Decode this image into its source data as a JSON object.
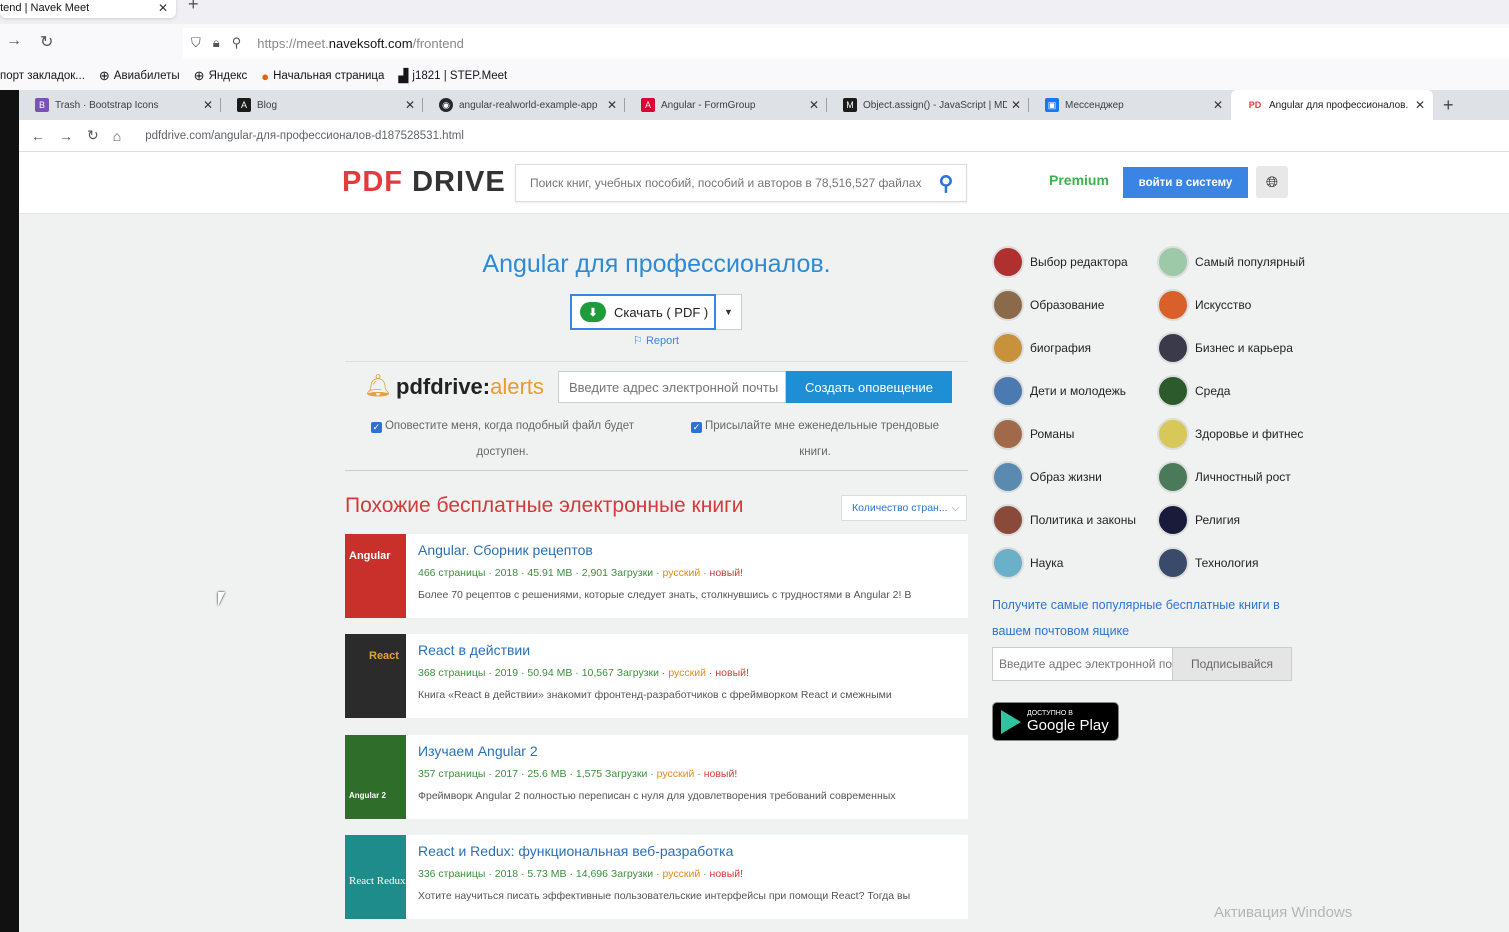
{
  "outer_browser": {
    "tab_title": "ntend | Navek Meet",
    "url_prefix": "https://meet.",
    "url_domain": "naveksoft.com",
    "url_path": "/frontend",
    "bookmarks": [
      {
        "label": "порт закладок...",
        "icon": "folder-icon"
      },
      {
        "label": "Авиабилеты",
        "icon": "globe-icon"
      },
      {
        "label": "Яндекс",
        "icon": "globe-icon"
      },
      {
        "label": "Начальная страница",
        "icon": "firefox-icon"
      },
      {
        "label": "j1821 | STEP.Meet",
        "icon": "factory-icon"
      }
    ]
  },
  "inner_browser": {
    "tabs": [
      {
        "label": "Trash · Bootstrap Icons",
        "favicon": "B",
        "color": "#7952b3"
      },
      {
        "label": "Blog",
        "favicon": "A",
        "color": "#1a1a1a"
      },
      {
        "label": "angular-realworld-example-app",
        "favicon": "◉",
        "color": "#24292e"
      },
      {
        "label": "Angular - FormGroup",
        "favicon": "A",
        "color": "#dd0031"
      },
      {
        "label": "Object.assign() - JavaScript | MD",
        "favicon": "M",
        "color": "#1b1b1b"
      },
      {
        "label": "Мессенджер",
        "favicon": "▣",
        "color": "#1877f2"
      },
      {
        "label": "Angular для профессионалов.",
        "favicon": "PD",
        "color": "#ffffff"
      }
    ],
    "url": "pdfdrive.com/angular-для-профессионалов-d187528531.html"
  },
  "header": {
    "logo_pdf": "PDF",
    "logo_drive": "DRIVE",
    "search_placeholder": "Поиск книг, учебных пособий, пособий и авторов в 78,516,527 файлах",
    "premium": "Premium",
    "login": "войти в систему"
  },
  "book": {
    "title": "Angular для профессионалов.",
    "download_label": "Скачать ( PDF )",
    "report": "Report"
  },
  "alerts": {
    "logo_main": "pdfdrive:",
    "logo_accent": "alerts",
    "email_placeholder": "Введите адрес электронной почты",
    "create_button": "Создать оповещение",
    "check1": "Оповестите меня, когда подобный файл будет доступен.",
    "check2": "Присылайте мне еженедельные трендовые книги."
  },
  "similar": {
    "title": "Похожие бесплатные электронные книги",
    "sort_label": "Количество стран..."
  },
  "books": [
    {
      "title": "Angular. Сборник рецептов",
      "meta": "466 страницы · 2018 · 45.91 MB · 2,901 Загрузки",
      "lang": "русский",
      "new": "новый!",
      "desc": "Более 70 рецептов с решениями, которые следует знать, столкнувшись с трудностями в Angular 2! В",
      "cover_color": "#c9302c",
      "cover_text": "Angular"
    },
    {
      "title": "React в действии",
      "meta": "368 страницы · 2019 · 50.94 MB · 10,567 Загрузки",
      "lang": "русский",
      "new": "новый!",
      "desc": "Книга «React в действии» знакомит фронтенд-разработчиков с фреймворком React и смежными",
      "cover_color": "#2b2b2b",
      "cover_text": "React"
    },
    {
      "title": "Изучаем Angular 2",
      "meta": "357 страницы · 2017 · 25.6 MB · 1,575 Загрузки",
      "lang": "русский",
      "new": "новый!",
      "desc": "Фреймворк Angular 2 полностью переписан с нуля для удовлетворения требований современных",
      "cover_color": "#2f6e2a",
      "cover_text": "Angular 2"
    },
    {
      "title": "React и Redux: функциональная веб-разработка",
      "meta": "336 страницы · 2018 · 5.73 MB · 14,696 Загрузки",
      "lang": "русский",
      "new": "новый!",
      "desc": "Хотите научиться писать эффективные пользовательские интерфейсы при помощи React? Тогда вы",
      "cover_color": "#1f8c8c",
      "cover_text": "React Redux"
    }
  ],
  "categories": [
    {
      "label": "Выбор редактора",
      "color": "#b03030"
    },
    {
      "label": "Самый популярный",
      "color": "#9ec9a8"
    },
    {
      "label": "Образование",
      "color": "#8a6a4a"
    },
    {
      "label": "Искусство",
      "color": "#d9602a"
    },
    {
      "label": "биография",
      "color": "#c8923c"
    },
    {
      "label": "Бизнес и карьера",
      "color": "#3a3a4a"
    },
    {
      "label": "Дети и молодежь",
      "color": "#4a7ab0"
    },
    {
      "label": "Среда",
      "color": "#2d5a2d"
    },
    {
      "label": "Романы",
      "color": "#a06a4a"
    },
    {
      "label": "Здоровье и фитнес",
      "color": "#d8c85a"
    },
    {
      "label": "Образ жизни",
      "color": "#5a8ab0"
    },
    {
      "label": "Личностный рост",
      "color": "#4a7a5a"
    },
    {
      "label": "Политика и законы",
      "color": "#8a4a3a"
    },
    {
      "label": "Религия",
      "color": "#1a1a3a"
    },
    {
      "label": "Наука",
      "color": "#6ab0c8"
    },
    {
      "label": "Технология",
      "color": "#3a4a6a"
    }
  ],
  "newsletter": {
    "promo": "Получите самые популярные бесплатные книги в вашем почтовом ящике",
    "email_placeholder": "Введите адрес электронной почты",
    "subscribe": "Подписывайся",
    "gplay_small": "ДОСТУПНО В",
    "gplay_big": "Google Play"
  },
  "watermark": "Активация Windows"
}
